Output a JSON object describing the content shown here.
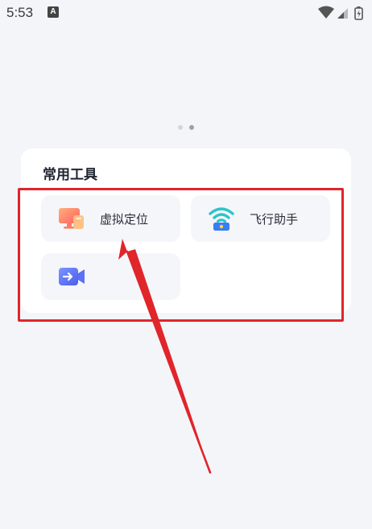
{
  "status_bar": {
    "time": "5:53",
    "notification_letter": "A"
  },
  "carousel": {
    "page_count": 2,
    "active_index": 1
  },
  "tools_section": {
    "title": "常用工具",
    "tools": [
      {
        "label": "虚拟定位",
        "icon": "virtual-location-icon"
      },
      {
        "label": "飞行助手",
        "icon": "wifi-flight-assistant-icon"
      },
      {
        "label": "",
        "icon": "video-camera-icon"
      }
    ]
  },
  "annotation": {
    "color": "#e0252b"
  }
}
